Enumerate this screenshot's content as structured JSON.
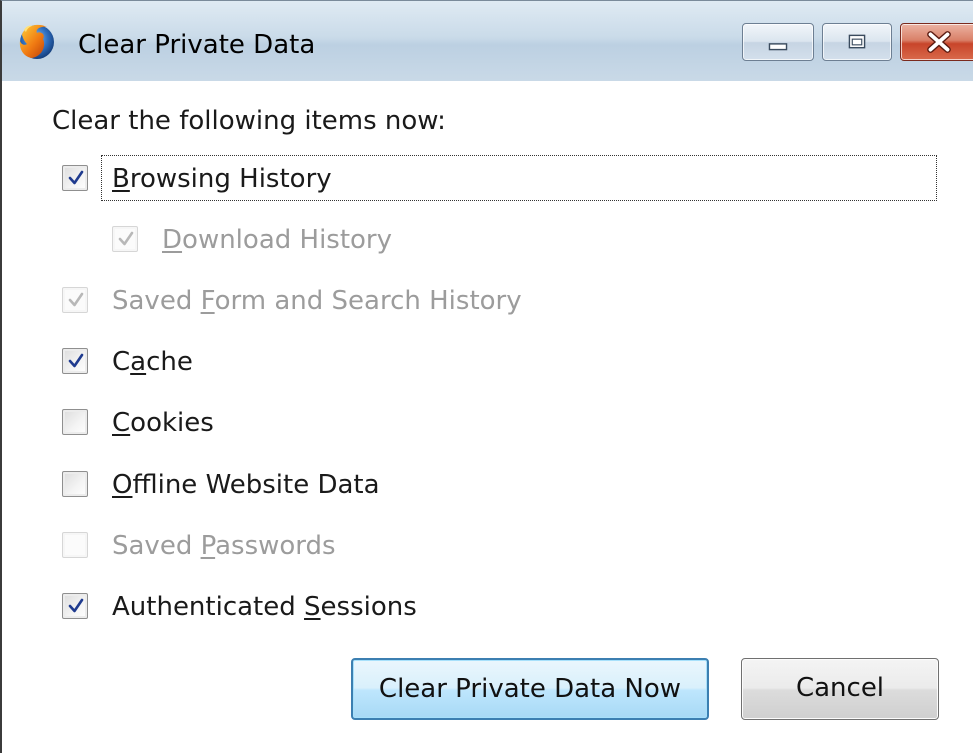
{
  "window": {
    "title": "Clear Private Data",
    "app_icon": "firefox-icon",
    "controls": [
      "minimize-icon",
      "maximize-icon",
      "close-icon"
    ]
  },
  "heading": "Clear the following items now:",
  "options": [
    {
      "id": "browsing-history",
      "pre": "",
      "key": "B",
      "post": "rowsing History",
      "checked": true,
      "enabled": true,
      "focused": true
    },
    {
      "id": "download-history",
      "pre": "",
      "key": "D",
      "post": "ownload History",
      "checked": true,
      "enabled": false
    },
    {
      "id": "saved-form-history",
      "pre": "Saved ",
      "key": "F",
      "post": "orm and Search History",
      "checked": true,
      "enabled": false
    },
    {
      "id": "cache",
      "pre": "C",
      "key": "a",
      "post": "che",
      "checked": true,
      "enabled": true
    },
    {
      "id": "cookies",
      "pre": "",
      "key": "C",
      "post": "ookies",
      "checked": false,
      "enabled": true
    },
    {
      "id": "offline-website-data",
      "pre": "",
      "key": "O",
      "post": "ffline Website Data",
      "checked": false,
      "enabled": true
    },
    {
      "id": "saved-passwords",
      "pre": "Saved ",
      "key": "P",
      "post": "asswords",
      "checked": false,
      "enabled": false
    },
    {
      "id": "authenticated-sessions",
      "pre": "Authenticated ",
      "key": "S",
      "post": "essions",
      "checked": true,
      "enabled": true
    }
  ],
  "buttons": {
    "clear_now": "Clear Private Data Now",
    "cancel": "Cancel"
  },
  "colors": {
    "check": "#1f3b8f",
    "check_disabled": "#b8b8b8",
    "primary_border": "#3c7fb1"
  }
}
